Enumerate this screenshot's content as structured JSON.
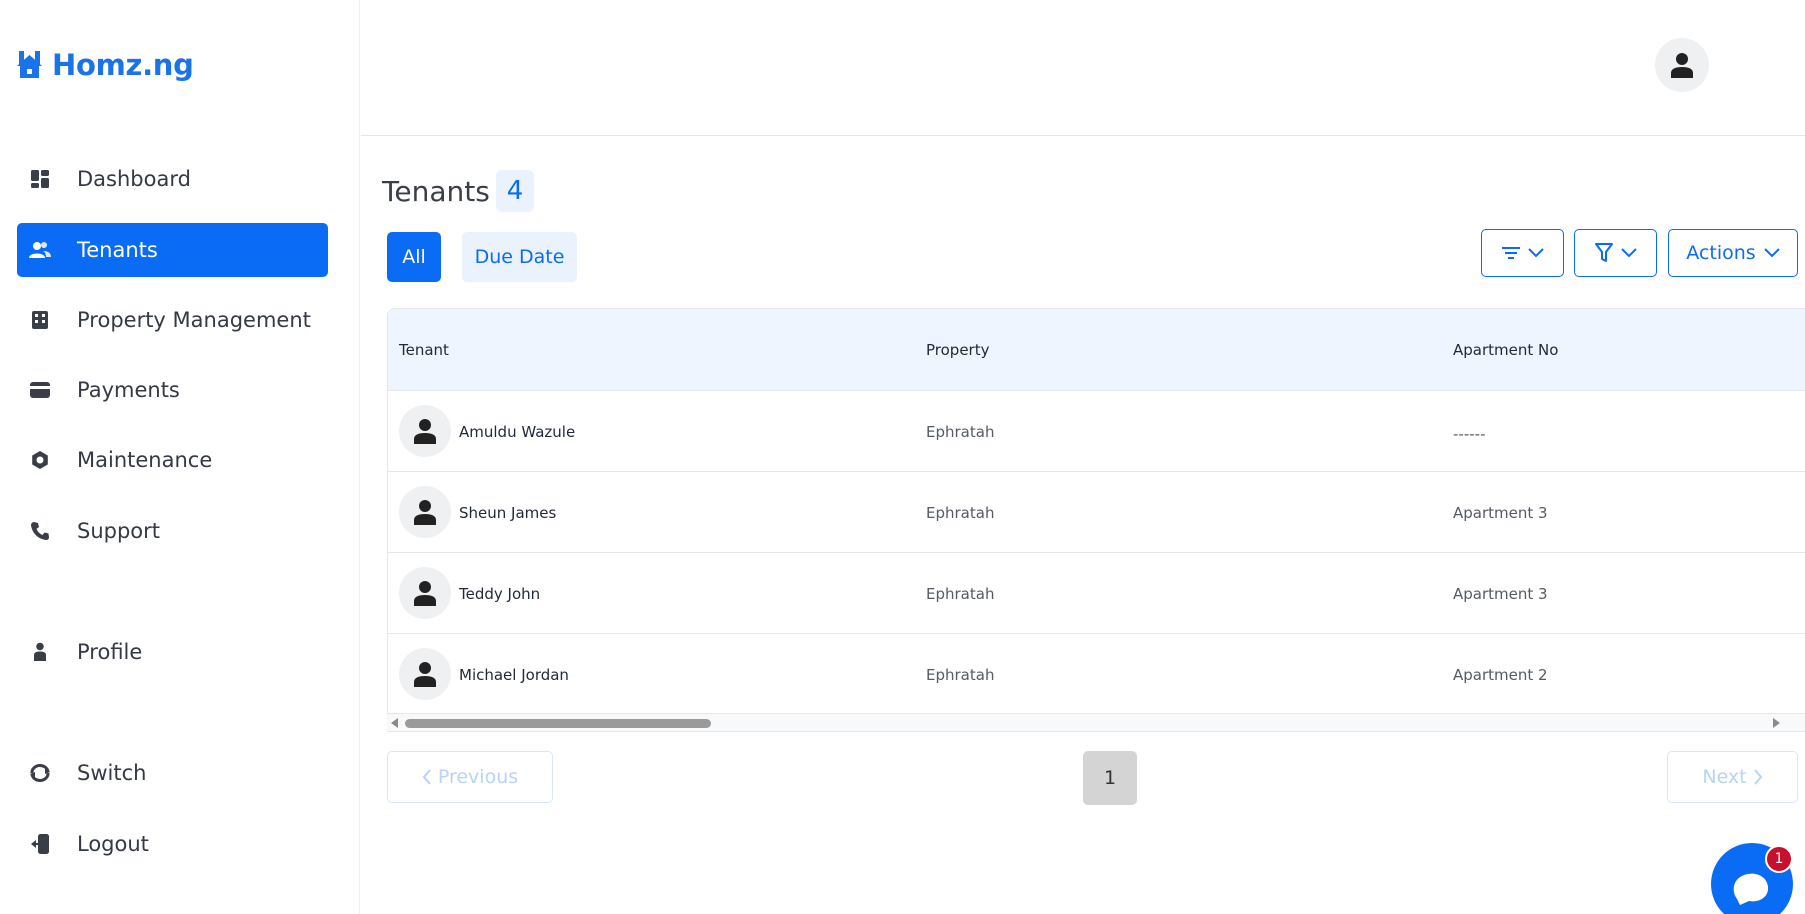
{
  "brand": {
    "name": "Homz.ng",
    "icon": "house-logo-icon",
    "color": "#1a73e8"
  },
  "sidebar": {
    "items": [
      {
        "label": "Dashboard",
        "icon": "dashboard-icon",
        "active": false
      },
      {
        "label": "Tenants",
        "icon": "users-icon",
        "active": true
      },
      {
        "label": "Property Management",
        "icon": "building-icon",
        "active": false
      },
      {
        "label": "Payments",
        "icon": "card-icon",
        "active": false
      },
      {
        "label": "Maintenance",
        "icon": "gear-icon",
        "active": false
      },
      {
        "label": "Support",
        "icon": "phone-icon",
        "active": false
      },
      {
        "label": "Profile",
        "icon": "person-icon",
        "active": false
      },
      {
        "label": "Switch",
        "icon": "switch-icon",
        "active": false
      },
      {
        "label": "Logout",
        "icon": "logout-icon",
        "active": false
      }
    ]
  },
  "header": {
    "user_icon": "user-avatar-icon"
  },
  "main": {
    "title": "Tenants",
    "count": "4",
    "tabs": [
      {
        "label": "All",
        "active": true
      },
      {
        "label": "Due Date",
        "active": false
      }
    ],
    "toolbar": {
      "sort_icon": "sort-icon",
      "filter_icon": "filter-icon",
      "actions_label": "Actions"
    },
    "table": {
      "columns": [
        "Tenant",
        "Property",
        "Apartment No"
      ],
      "rows": [
        {
          "tenant": "Amuldu Wazule",
          "property": "Ephratah",
          "apartment": "------"
        },
        {
          "tenant": "Sheun James",
          "property": "Ephratah",
          "apartment": "Apartment 3"
        },
        {
          "tenant": "Teddy John",
          "property": "Ephratah",
          "apartment": "Apartment 3"
        },
        {
          "tenant": "Michael Jordan",
          "property": "Ephratah",
          "apartment": "Apartment 2"
        }
      ]
    },
    "pagination": {
      "previous": "Previous",
      "next": "Next",
      "current": "1"
    }
  },
  "chat": {
    "badge": "1",
    "icon": "chat-icon"
  },
  "colors": {
    "accent": "#0a6cf5",
    "header_bg": "#eef5fe",
    "badge_red": "#c8102e"
  }
}
